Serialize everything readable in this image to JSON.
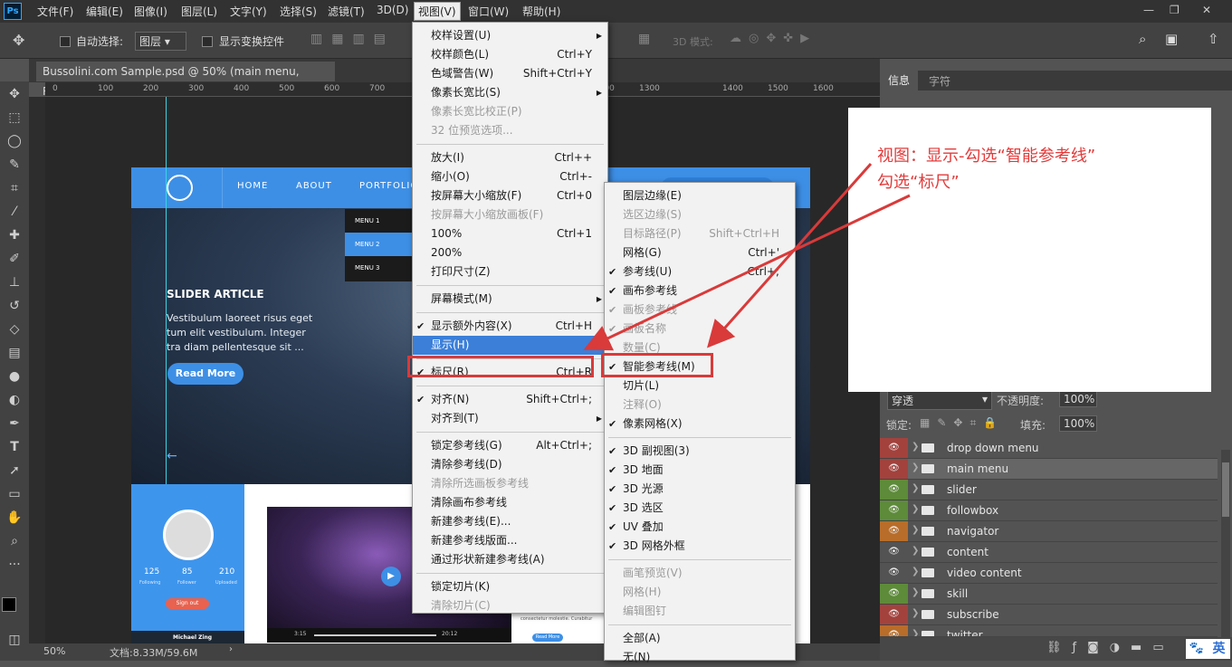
{
  "app": {
    "logo": "Ps",
    "window_controls": [
      "—",
      "❐",
      "✕"
    ]
  },
  "menubar": {
    "items": [
      "文件(F)",
      "编辑(E)",
      "图像(I)",
      "图层(L)",
      "文字(Y)",
      "选择(S)",
      "滤镜(T)",
      "3D(D)",
      "视图(V)",
      "窗口(W)",
      "帮助(H)"
    ],
    "active": "视图(V)"
  },
  "options": {
    "auto_select": "自动选择:",
    "layer_select": "图层",
    "show_transform": "显示变换控件",
    "mode_3d": "3D 模式:"
  },
  "document": {
    "tab": "Bussolini.com Sample.psd @ 50% (main menu, RGB/8#) *",
    "ruler_top": [
      "0",
      "100",
      "200",
      "300",
      "400",
      "500",
      "600",
      "700",
      "800",
      "900",
      "1000",
      "1100",
      "1200",
      "1300",
      "1400",
      "1500",
      "1600"
    ],
    "zoom": "50%",
    "doc_size": "文档:8.33M/59.6M"
  },
  "website": {
    "nav": [
      "HOME",
      "ABOUT",
      "PORTFOLIO"
    ],
    "dropdown": [
      "MENU 1",
      "MENU 2",
      "MENU 3"
    ],
    "slider_title": "SLIDER ARTICLE",
    "slider_text": [
      "Vestibulum laoreet risus eget",
      "tum elit vestibulum. Integer",
      "tra diam pellentesque sit ..."
    ],
    "read_more": "Read More",
    "stats": [
      {
        "value": "125",
        "label": "Following"
      },
      {
        "value": "85",
        "label": "Follower"
      },
      {
        "value": "210",
        "label": "Uploaded"
      }
    ],
    "sign_out": "Sign out",
    "profile_name": "Michael Zing",
    "video_time_a": "3:15",
    "video_time_b": "20:12",
    "small_read_more": "Read More",
    "small_text": "consectetur molestie. Curabitur"
  },
  "view_menu": [
    {
      "label": "校样设置(U)",
      "submenu": true
    },
    {
      "label": "校样颜色(L)",
      "shortcut": "Ctrl+Y"
    },
    {
      "label": "色域警告(W)",
      "shortcut": "Shift+Ctrl+Y"
    },
    {
      "label": "像素长宽比(S)",
      "submenu": true
    },
    {
      "label": "像素长宽比校正(P)",
      "disabled": true
    },
    {
      "label": "32 位预览选项...",
      "disabled": true
    },
    {
      "sep": true
    },
    {
      "label": "放大(I)",
      "shortcut": "Ctrl++"
    },
    {
      "label": "缩小(O)",
      "shortcut": "Ctrl+-"
    },
    {
      "label": "按屏幕大小缩放(F)",
      "shortcut": "Ctrl+0"
    },
    {
      "label": "按屏幕大小缩放画板(F)",
      "disabled": true
    },
    {
      "label": "100%",
      "shortcut": "Ctrl+1"
    },
    {
      "label": "200%"
    },
    {
      "label": "打印尺寸(Z)"
    },
    {
      "sep": true
    },
    {
      "label": "屏幕模式(M)",
      "submenu": true
    },
    {
      "sep": true
    },
    {
      "label": "显示额外内容(X)",
      "shortcut": "Ctrl+H",
      "checked": true
    },
    {
      "label": "显示(H)",
      "submenu": true,
      "highlighted": true
    },
    {
      "sep": true
    },
    {
      "label": "标尺(R)",
      "shortcut": "Ctrl+R",
      "checked": true
    },
    {
      "sep": true
    },
    {
      "label": "对齐(N)",
      "shortcut": "Shift+Ctrl+;",
      "checked": true
    },
    {
      "label": "对齐到(T)",
      "submenu": true
    },
    {
      "sep": true
    },
    {
      "label": "锁定参考线(G)",
      "shortcut": "Alt+Ctrl+;"
    },
    {
      "label": "清除参考线(D)"
    },
    {
      "label": "清除所选画板参考线",
      "disabled": true
    },
    {
      "label": "清除画布参考线"
    },
    {
      "label": "新建参考线(E)..."
    },
    {
      "label": "新建参考线版面..."
    },
    {
      "label": "通过形状新建参考线(A)"
    },
    {
      "sep": true
    },
    {
      "label": "锁定切片(K)"
    },
    {
      "label": "清除切片(C)",
      "disabled": true
    }
  ],
  "show_menu": [
    {
      "label": "图层边缘(E)"
    },
    {
      "label": "选区边缘(S)",
      "disabled": true
    },
    {
      "label": "目标路径(P)",
      "shortcut": "Shift+Ctrl+H",
      "disabled": true
    },
    {
      "label": "网格(G)",
      "shortcut": "Ctrl+'"
    },
    {
      "label": "参考线(U)",
      "shortcut": "Ctrl+;",
      "checked": true
    },
    {
      "label": "画布参考线",
      "checked": true
    },
    {
      "label": "画板参考线",
      "checked": true,
      "disabled": true
    },
    {
      "label": "画板名称",
      "checked": true,
      "disabled": true
    },
    {
      "label": "数量(C)",
      "disabled": true
    },
    {
      "label": "智能参考线(M)",
      "checked": true
    },
    {
      "label": "切片(L)"
    },
    {
      "label": "注释(O)",
      "disabled": true
    },
    {
      "label": "像素网格(X)",
      "checked": true
    },
    {
      "sep": true
    },
    {
      "label": "3D 副视图(3)",
      "checked": true
    },
    {
      "label": "3D 地面",
      "checked": true
    },
    {
      "label": "3D 光源",
      "checked": true
    },
    {
      "label": "3D 选区",
      "checked": true
    },
    {
      "label": "UV 叠加",
      "checked": true
    },
    {
      "label": "3D 网格外框",
      "checked": true
    },
    {
      "sep": true
    },
    {
      "label": "画笔预览(V)",
      "disabled": true
    },
    {
      "label": "网格(H)",
      "disabled": true
    },
    {
      "label": "编辑图钉",
      "disabled": true
    },
    {
      "sep": true
    },
    {
      "label": "全部(A)"
    },
    {
      "label": "无(N)"
    }
  ],
  "annotation": {
    "line1": "视图：显示-勾选“智能参考线”",
    "line2": "勾选“标尺”",
    "color": "#d93a3a"
  },
  "panels": {
    "info_tab": "信息",
    "char_tab": "字符",
    "blend_mode": "穿透",
    "opacity_label": "不透明度:",
    "opacity_value": "100%",
    "lock_label": "锁定:",
    "fill_label": "填充:",
    "fill_value": "100%",
    "layers": [
      {
        "name": "drop down menu",
        "color": "#a3423d"
      },
      {
        "name": "main menu",
        "color": "#a3423d",
        "selected": true
      },
      {
        "name": "slider",
        "color": "#5d8b3a"
      },
      {
        "name": "followbox",
        "color": "#5d8b3a"
      },
      {
        "name": "navigator",
        "color": "#b86d2a"
      },
      {
        "name": "content",
        "color": "#535353"
      },
      {
        "name": "video content",
        "color": "#535353"
      },
      {
        "name": "skill",
        "color": "#5d8b3a"
      },
      {
        "name": "subscribe",
        "color": "#a3423d"
      },
      {
        "name": "twitter",
        "color": "#b86d2a"
      }
    ],
    "ime_label": "英"
  }
}
